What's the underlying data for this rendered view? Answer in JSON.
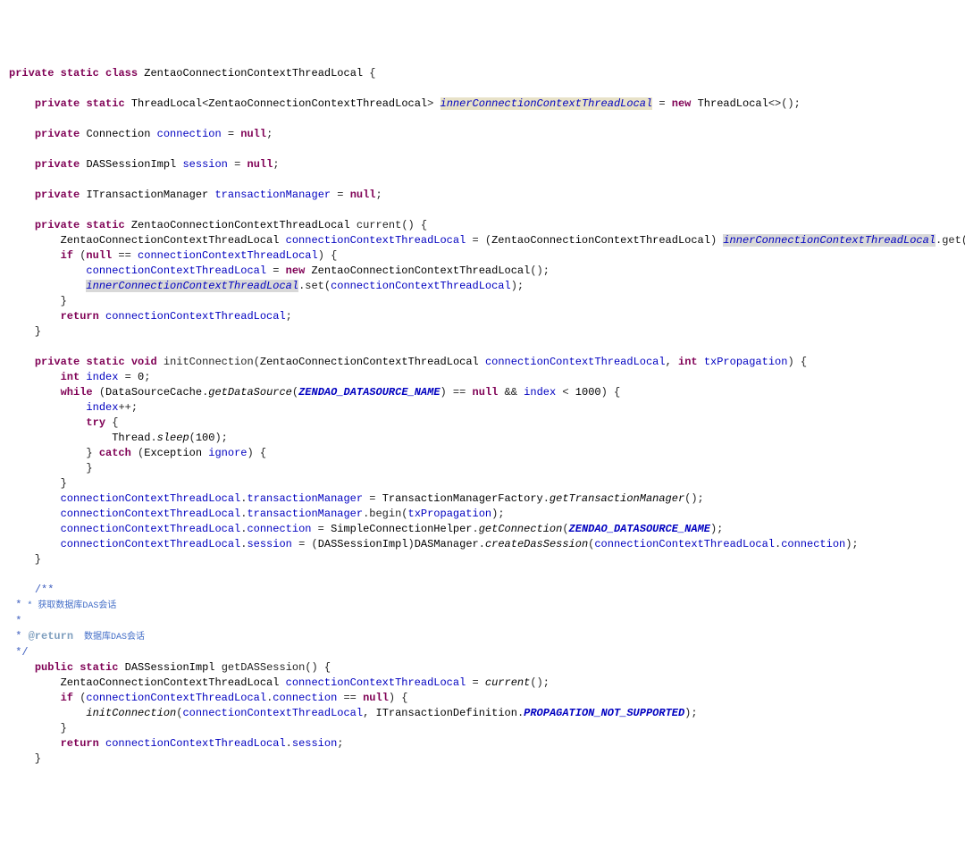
{
  "kw": {
    "private": "private",
    "static": "static",
    "class": "class",
    "new": "new",
    "null": "null",
    "if": "if",
    "return": "return",
    "void": "void",
    "int": "int",
    "while": "while",
    "try": "try",
    "catch": "catch",
    "public": "public"
  },
  "types": {
    "ZentaoConnectionContextThreadLocal": "ZentaoConnectionContextThreadLocal",
    "ThreadLocal": "ThreadLocal",
    "Connection": "Connection",
    "DASSessionImpl": "DASSessionImpl",
    "ITransactionManager": "ITransactionManager",
    "DataSourceCache": "DataSourceCache",
    "Thread": "Thread",
    "Exception": "Exception",
    "TransactionManagerFactory": "TransactionManagerFactory",
    "SimpleConnectionHelper": "SimpleConnectionHelper",
    "DASManager": "DASManager",
    "ITransactionDefinition": "ITransactionDefinition"
  },
  "fields": {
    "innerConnectionContextThreadLocal": "innerConnectionContextThreadLocal",
    "connection": "connection",
    "session": "session",
    "transactionManager": "transactionManager"
  },
  "vars": {
    "connectionContextThreadLocal": "connectionContextThreadLocal",
    "txPropagation": "txPropagation",
    "index": "index",
    "ignore": "ignore"
  },
  "methods": {
    "current": "current",
    "get": "get",
    "set": "set",
    "initConnection": "initConnection",
    "getDataSource": "getDataSource",
    "sleep": "sleep",
    "getTransactionManager": "getTransactionManager",
    "begin": "begin",
    "getConnection": "getConnection",
    "createDasSession": "createDasSession",
    "getDASSession": "getDASSession"
  },
  "consts": {
    "ZENDAO_DATASOURCE_NAME": "ZENDAO_DATASOURCE_NAME",
    "PROPAGATION_NOT_SUPPORTED": "PROPAGATION_NOT_SUPPORTED"
  },
  "nums": {
    "zero": "0",
    "thousand": "1000",
    "hundred": "100"
  },
  "comments": {
    "open": "/**",
    "star": " *",
    "line1": " * 获取数据库DAS会话",
    "returnTag": "@return",
    "returnText": "  数据库DAS会话",
    "close": " */"
  }
}
